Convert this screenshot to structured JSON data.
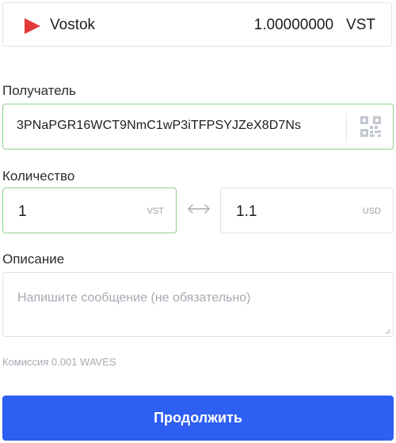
{
  "asset": {
    "name": "Vostok",
    "amount": "1.00000000",
    "ticker": "VST",
    "icon": "vostok-play-icon",
    "icon_color": "#e23a3a"
  },
  "recipient": {
    "label": "Получатель",
    "value": "3PNaPGR16WCT9NmC1wP3iTFPSYJZeX8D7Ns",
    "qr_icon": "qr-code-icon"
  },
  "amount": {
    "label": "Количество",
    "asset_value": "1",
    "asset_unit": "VST",
    "fiat_value": "1.1",
    "fiat_unit": "USD",
    "swap_icon": "swap-arrows-icon"
  },
  "description": {
    "label": "Описание",
    "placeholder": "Напишите сообщение (не обязательно)"
  },
  "fee": "Комиссия 0.001 WAVES",
  "continue_label": "Продолжить",
  "colors": {
    "accent": "#2e5ff2",
    "valid_border": "#8fd08a",
    "border": "#dfe2e7"
  }
}
